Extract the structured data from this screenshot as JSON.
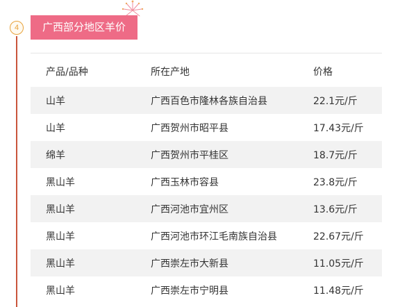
{
  "section": {
    "number": "4",
    "title": "广西部分地区羊价"
  },
  "colors": {
    "tag_bg": "#ee6b86",
    "line": "#c9553b",
    "circle": "#e8a23a",
    "row_shade": "#f2f2f2"
  },
  "table": {
    "headers": [
      "产品/品种",
      "所在产地",
      "价格"
    ],
    "rows": [
      [
        "山羊",
        "广西百色市隆林各族自治县",
        "22.1元/斤"
      ],
      [
        "山羊",
        "广西贺州市昭平县",
        "17.43元/斤"
      ],
      [
        "绵羊",
        "广西贺州市平桂区",
        "18.7元/斤"
      ],
      [
        "黑山羊",
        "广西玉林市容县",
        "23.8元/斤"
      ],
      [
        "黑山羊",
        "广西河池市宜州区",
        "13.6元/斤"
      ],
      [
        "黑山羊",
        "广西河池市环江毛南族自治县",
        "22.67元/斤"
      ],
      [
        "黑山羊",
        "广西崇左市大新县",
        "11.05元/斤"
      ],
      [
        "黑山羊",
        "广西崇左市宁明县",
        "11.48元/斤"
      ]
    ]
  }
}
